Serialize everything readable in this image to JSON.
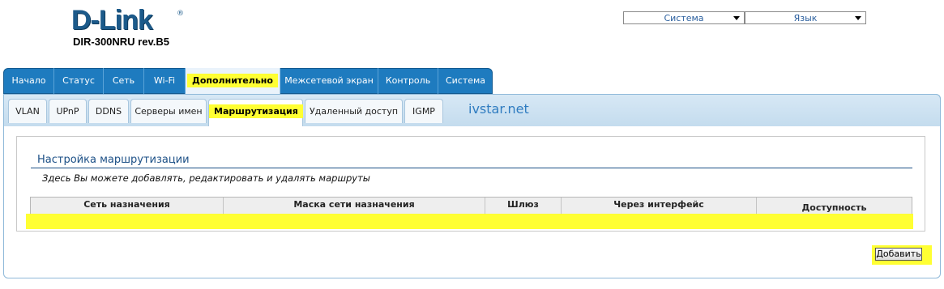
{
  "logo": {
    "brand": "D-Link",
    "reg": "®",
    "model": "DIR-300NRU rev.B5"
  },
  "top_selects": [
    {
      "label": "Система"
    },
    {
      "label": "Язык"
    }
  ],
  "main_tabs": [
    {
      "label": "Начало"
    },
    {
      "label": "Статус"
    },
    {
      "label": "Сеть"
    },
    {
      "label": "Wi-Fi"
    },
    {
      "label": "Дополнительно",
      "active": true
    },
    {
      "label": "Межсетевой экран"
    },
    {
      "label": "Контроль"
    },
    {
      "label": "Система"
    }
  ],
  "sub_tabs": [
    {
      "label": "VLAN"
    },
    {
      "label": "UPnP"
    },
    {
      "label": "DDNS"
    },
    {
      "label": "Серверы имен"
    },
    {
      "label": "Маршрутизация",
      "active": true
    },
    {
      "label": "Удаленный доступ"
    },
    {
      "label": "IGMP"
    }
  ],
  "watermark": "ivstar.net",
  "section": {
    "title": "Настройка маршрутизации",
    "description": "Здесь Вы можете добавлять, редактировать и удалять маршруты"
  },
  "table": {
    "columns": [
      "Сеть назначения",
      "Маска сети назначения",
      "Шлюз",
      "Через интерфейс",
      "Доступность"
    ],
    "rows": []
  },
  "add_button": "Добавить",
  "colors": {
    "accent": "#1e7bbf",
    "highlight": "#ffff33",
    "title": "#1b4f86"
  }
}
